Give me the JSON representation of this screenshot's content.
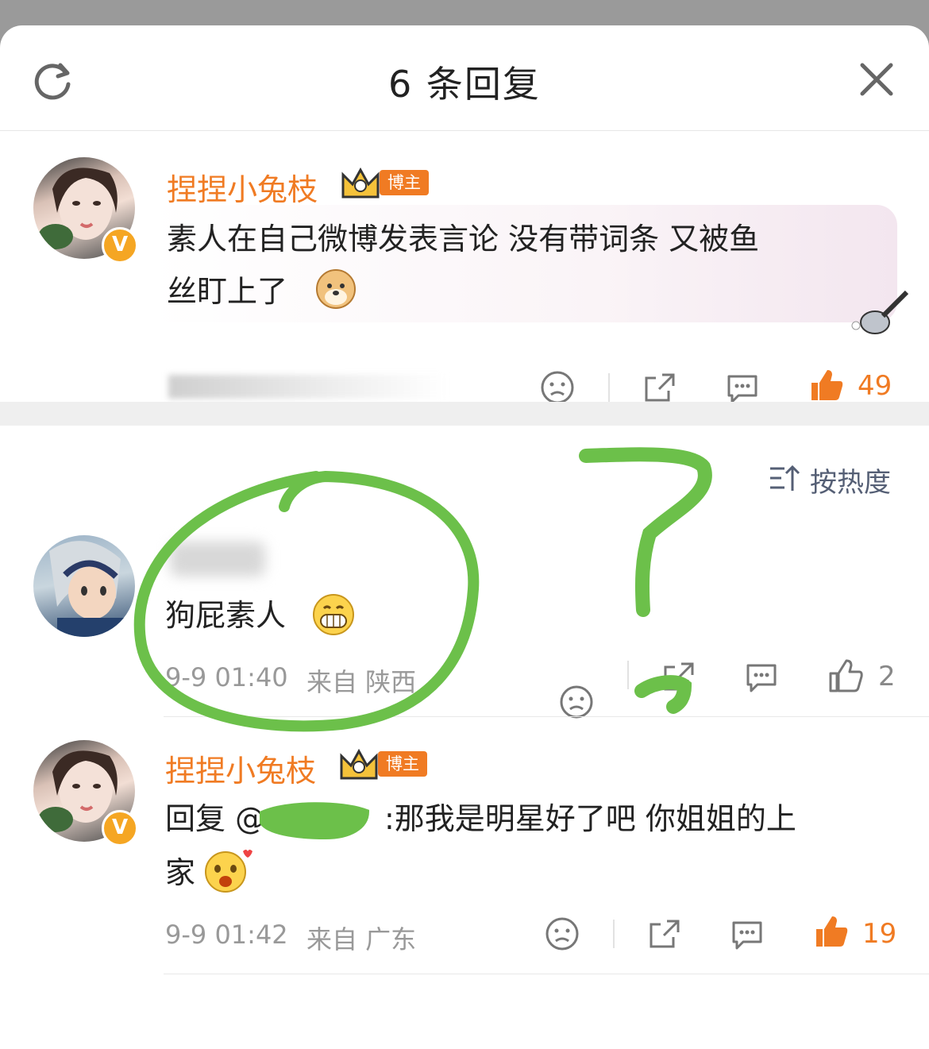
{
  "header": {
    "title": "6 条回复"
  },
  "pinned_comment": {
    "author": "捏捏小兔枝",
    "badge": "博主",
    "text_line1": "素人在自己微博发表言论 没有带词条 又被鱼",
    "text_line2": "丝盯上了",
    "likes": "49"
  },
  "sort": {
    "label": "按热度"
  },
  "replies": [
    {
      "text": "狗屁素人",
      "date": "9-9 01:40",
      "source": "来自 陕西",
      "likes": "2"
    },
    {
      "author": "捏捏小兔枝",
      "badge": "博主",
      "reply_prefix": "回复 @",
      "text_line1_rest": ":那我是明星好了吧 你姐姐的上",
      "text_line2": "家",
      "date": "9-9 01:42",
      "source": "来自 广东",
      "likes": "19"
    }
  ],
  "colors": {
    "accent": "#f07b23",
    "annotation": "#6cc04a"
  }
}
